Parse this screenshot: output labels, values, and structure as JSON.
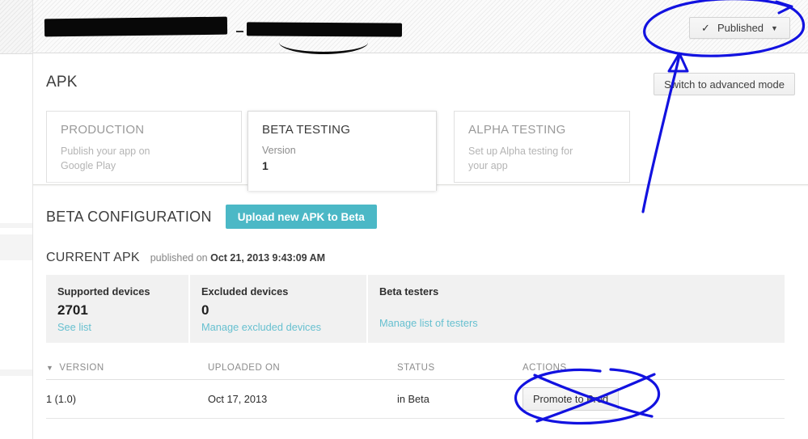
{
  "header": {
    "app_title_redacted": true,
    "publish_status": {
      "check_icon": "check-icon",
      "label": "Published",
      "caret_icon": "chevron-down-icon"
    }
  },
  "main": {
    "section_title": "APK",
    "advanced_mode_label": "Switch to advanced mode",
    "tracks": [
      {
        "key": "production",
        "name": "PRODUCTION",
        "desc_line1": "Publish your app on",
        "desc_line2": "Google Play",
        "active": false
      },
      {
        "key": "beta",
        "name": "BETA TESTING",
        "sub_label": "Version",
        "version": "1",
        "active": true
      },
      {
        "key": "alpha",
        "name": "ALPHA TESTING",
        "desc_line1": "Set up Alpha testing for",
        "desc_line2": "your app",
        "active": false
      }
    ],
    "beta_config": {
      "title": "BETA CONFIGURATION",
      "upload_button": "Upload new APK to Beta"
    },
    "current_apk": {
      "label": "CURRENT APK",
      "published_prefix": "published on",
      "published_date": "Oct 21, 2013 9:43:09 AM"
    },
    "stats": [
      {
        "key": "supported-devices",
        "label": "Supported devices",
        "value": "2701",
        "link": "See list"
      },
      {
        "key": "excluded-devices",
        "label": "Excluded devices",
        "value": "0",
        "link": "Manage excluded devices"
      },
      {
        "key": "beta-testers",
        "label": "Beta testers",
        "value": "",
        "link": "Manage list of testers"
      }
    ],
    "apk_table": {
      "sort_caret_icon": "caret-down-icon",
      "columns": {
        "version": "VERSION",
        "uploaded_on": "UPLOADED ON",
        "status": "STATUS",
        "actions": "ACTIONS"
      },
      "rows": [
        {
          "version": "1 (1.0)",
          "uploaded_on": "Oct 17, 2013",
          "status": "in Beta",
          "action_label": "Promote to Prod"
        }
      ]
    }
  },
  "annotations": {
    "pen_color": "#1212e0",
    "marks": [
      {
        "name": "circle-around-published-button",
        "shape": "ellipse"
      },
      {
        "name": "arrow-pointing-to-published-button",
        "shape": "arrow"
      },
      {
        "name": "circle-around-promote-to-prod-button",
        "shape": "ellipse"
      },
      {
        "name": "cross-out-promote-to-prod-button",
        "shape": "x"
      }
    ],
    "redaction_color": "#080808"
  },
  "colors": {
    "accent_teal": "#4bb8c6",
    "link_blue": "#67c0d0",
    "pen_blue": "#1212e0"
  }
}
